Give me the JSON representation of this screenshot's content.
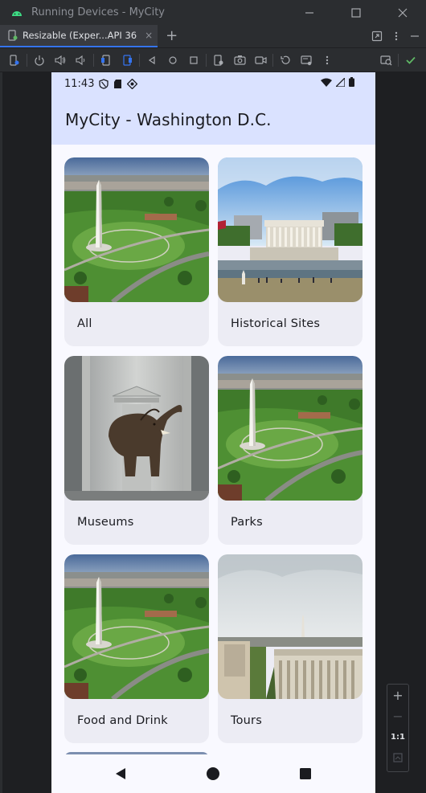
{
  "window": {
    "title": "Running Devices - MyCity"
  },
  "tab": {
    "label": "Resizable (Exper...API 36",
    "close": "×",
    "add": "+"
  },
  "colors": {
    "ide_bg": "#1e1f22",
    "ide_panel": "#2b2d30",
    "accent": "#3574f0",
    "app_bar": "#dae2ff",
    "screen_bg": "#f9f9ff",
    "card_bg": "#ececf4",
    "run_check": "#5fb865"
  },
  "zoom": {
    "zoom_in": "+",
    "zoom_out": "−",
    "actual_size": "1:1"
  },
  "device": {
    "status_time": "11:43",
    "app_title": "MyCity - Washington D.C.",
    "categories": [
      {
        "label": "All",
        "image": "washington-monument-aerial"
      },
      {
        "label": "Historical Sites",
        "image": "lincoln-memorial"
      },
      {
        "label": "Museums",
        "image": "museum-elephant"
      },
      {
        "label": "Parks",
        "image": "washington-monument-aerial"
      },
      {
        "label": "Food and Drink",
        "image": "washington-monument-aerial"
      },
      {
        "label": "Tours",
        "image": "treasury-view"
      }
    ]
  }
}
